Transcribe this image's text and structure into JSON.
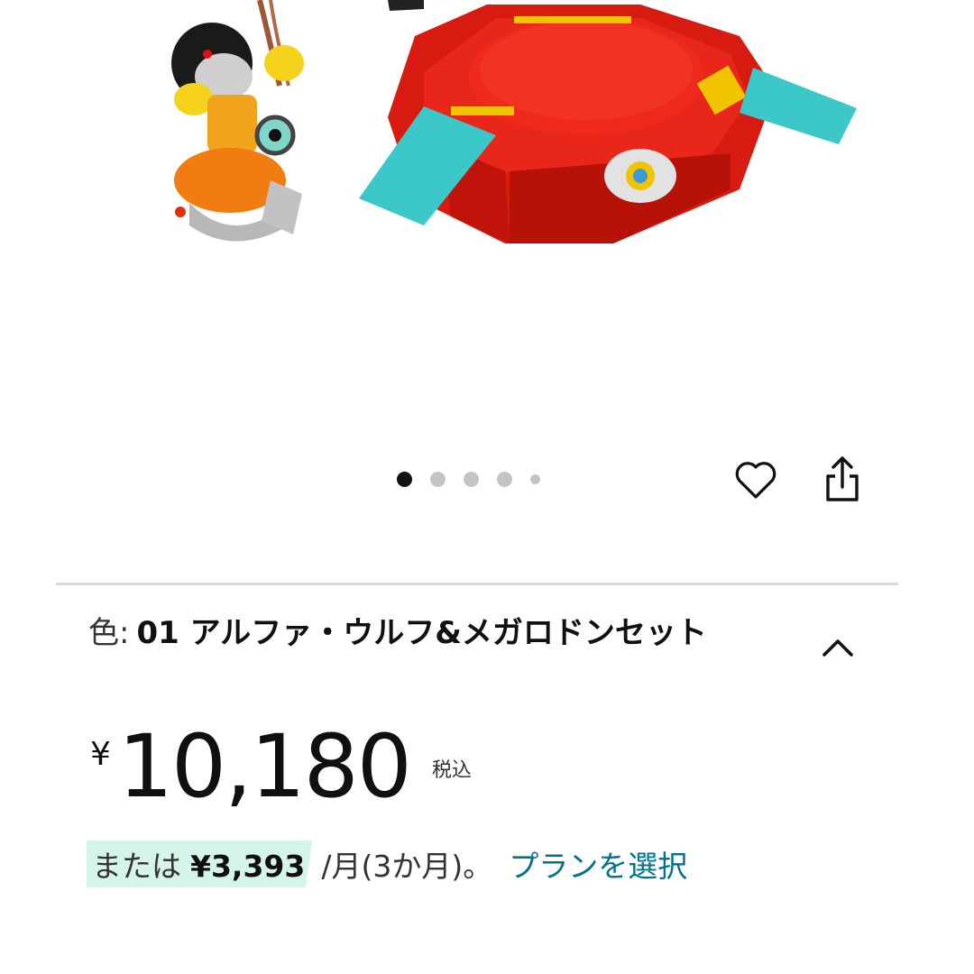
{
  "carousel": {
    "total_dots": 5,
    "active_index": 0
  },
  "actions": {
    "favorite_icon": "heart-icon",
    "share_icon": "share-icon"
  },
  "variant": {
    "label": "色:",
    "value": "01 アルファ・ウルフ&メガロドンセット",
    "toggle_icon": "chevron-up-icon"
  },
  "price": {
    "currency": "¥",
    "amount": "10,180",
    "tax_note": "税込"
  },
  "installment": {
    "prefix": "または",
    "amount": "¥3,393",
    "period": "/月(3か月)。",
    "link": "プランを選択"
  },
  "colors": {
    "link": "#00728a",
    "highlight": "#d6f5ea",
    "arena": "#e01e14",
    "ramp": "#3cc8c8"
  }
}
